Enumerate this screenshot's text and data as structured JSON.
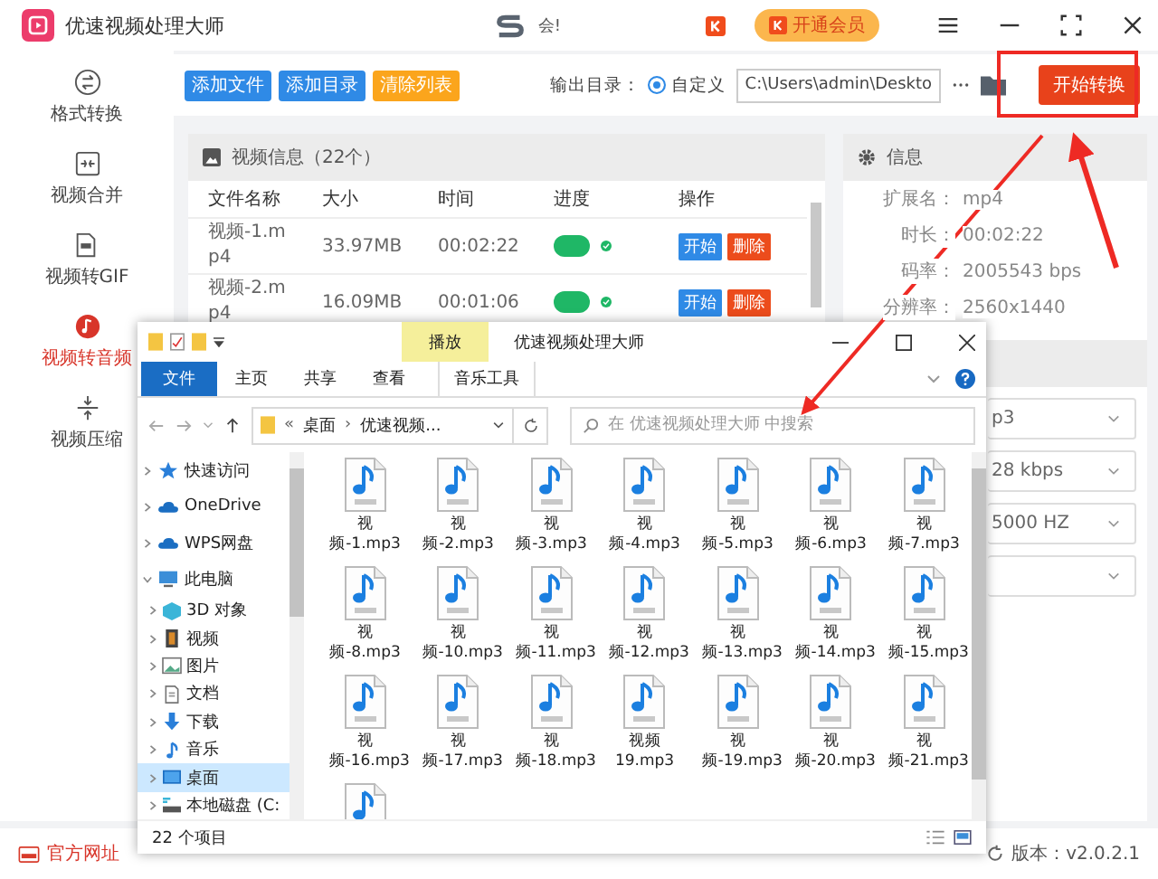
{
  "app": {
    "title": "优速视频处理大师",
    "promo_text": "会!",
    "vip_button": "开通会员"
  },
  "sidebar": {
    "items": [
      {
        "label": "格式转换",
        "selected": false
      },
      {
        "label": "视频合并",
        "selected": false
      },
      {
        "label": "视频转GIF",
        "selected": false
      },
      {
        "label": "视频转音频",
        "selected": true
      },
      {
        "label": "视频压缩",
        "selected": false
      }
    ],
    "footer_link": "官方网址"
  },
  "toolbar": {
    "buttons": [
      {
        "label": "添加文件",
        "kind": "primary"
      },
      {
        "label": "添加目录",
        "kind": "primary"
      },
      {
        "label": "清除列表",
        "kind": "warning"
      }
    ],
    "output_label": "输出目录：",
    "radio": {
      "label": "自定义",
      "selected": true
    },
    "path": "C:\\Users\\admin\\Deskto",
    "start_button": "开始转换"
  },
  "list_panel": {
    "title": "视频信息（22个）",
    "columns": [
      "文件名称",
      "大小",
      "时间",
      "进度",
      "操作"
    ],
    "rows": [
      {
        "name": "视频-1.mp4",
        "size": "33.97MB",
        "time": "00:02:22",
        "done": true,
        "actions": [
          "开始",
          "删除"
        ]
      },
      {
        "name": "视频-2.mp4",
        "size": "16.09MB",
        "time": "00:01:06",
        "done": true,
        "actions": [
          "开始",
          "删除"
        ]
      }
    ]
  },
  "info_panel": {
    "title": "信息",
    "fields": [
      {
        "label": "扩展名：",
        "value": "mp4"
      },
      {
        "label": "时长：",
        "value": "00:02:22"
      },
      {
        "label": "码率：",
        "value": "2005543 bps"
      },
      {
        "label": "分辨率：",
        "value": "2560x1440"
      }
    ]
  },
  "settings": {
    "dropdowns": [
      {
        "kind": "select",
        "value": "p3"
      },
      {
        "kind": "select",
        "value": "28 kbps"
      },
      {
        "kind": "select",
        "value": "5000 HZ"
      },
      {
        "kind": "select"
      }
    ]
  },
  "status_bar": {
    "version": "版本：v2.0.2.1"
  },
  "explorer": {
    "title": "优速视频处理大师",
    "context_tab": "播放",
    "ribbon_tabs": [
      {
        "label": "文件",
        "kind": "file"
      },
      {
        "label": "主页",
        "kind": "tab"
      },
      {
        "label": "共享",
        "kind": "tab"
      },
      {
        "label": "查看",
        "kind": "tab"
      },
      {
        "label": "音乐工具",
        "kind": "context"
      }
    ],
    "breadcrumb": [
      {
        "text": "«",
        "kind": "overflow"
      },
      {
        "text": "桌面",
        "kind": "folder"
      },
      {
        "text": "›",
        "kind": "separator"
      },
      {
        "text": "优速视频...",
        "kind": "folder"
      }
    ],
    "search": {
      "placeholder": "在 优速视频处理大师 中搜索"
    },
    "nav": [
      {
        "label": "快速访问",
        "expanded": false,
        "selected": false
      },
      {
        "label": "OneDrive",
        "expanded": false,
        "selected": false
      },
      {
        "label": "WPS网盘",
        "expanded": false,
        "selected": false
      },
      {
        "label": "此电脑",
        "expanded": true,
        "selected": false,
        "children": [
          {
            "label": "3D 对象",
            "selected": false
          },
          {
            "label": "视频",
            "selected": false
          },
          {
            "label": "图片",
            "selected": false
          },
          {
            "label": "文档",
            "selected": false
          },
          {
            "label": "下载",
            "selected": false
          },
          {
            "label": "音乐",
            "selected": false
          },
          {
            "label": "桌面",
            "selected": true
          },
          {
            "label": "本地磁盘 (C:",
            "selected": false
          }
        ]
      }
    ],
    "files": [
      {
        "kind": "mp3",
        "name": "视频-1.mp3"
      },
      {
        "kind": "mp3",
        "name": "视频-2.mp3"
      },
      {
        "kind": "mp3",
        "name": "视频-3.mp3"
      },
      {
        "kind": "mp3",
        "name": "视频-4.mp3"
      },
      {
        "kind": "mp3",
        "name": "视频-5.mp3"
      },
      {
        "kind": "mp3",
        "name": "视频-6.mp3"
      },
      {
        "kind": "mp3",
        "name": "视频-7.mp3"
      },
      {
        "kind": "mp3",
        "name": "视频-8.mp3"
      },
      {
        "kind": "mp3",
        "name": "视频-10.mp3"
      },
      {
        "kind": "mp3",
        "name": "视频-11.mp3"
      },
      {
        "kind": "mp3",
        "name": "视频-12.mp3"
      },
      {
        "kind": "mp3",
        "name": "视频-13.mp3"
      },
      {
        "kind": "mp3",
        "name": "视频-14.mp3"
      },
      {
        "kind": "mp3",
        "name": "视频-15.mp3"
      },
      {
        "kind": "mp3",
        "name": "视频-16.mp3"
      },
      {
        "kind": "mp3",
        "name": "视频-17.mp3"
      },
      {
        "kind": "mp3",
        "name": "视频-18.mp3"
      },
      {
        "kind": "mp3",
        "name": "视频 19.mp3"
      },
      {
        "kind": "mp3",
        "name": "视频-19.mp3"
      },
      {
        "kind": "mp3",
        "name": "视频-20.mp3"
      },
      {
        "kind": "mp3",
        "name": "视频-21.mp3"
      },
      {
        "kind": "mp3"
      }
    ],
    "status": "22 个项目"
  }
}
